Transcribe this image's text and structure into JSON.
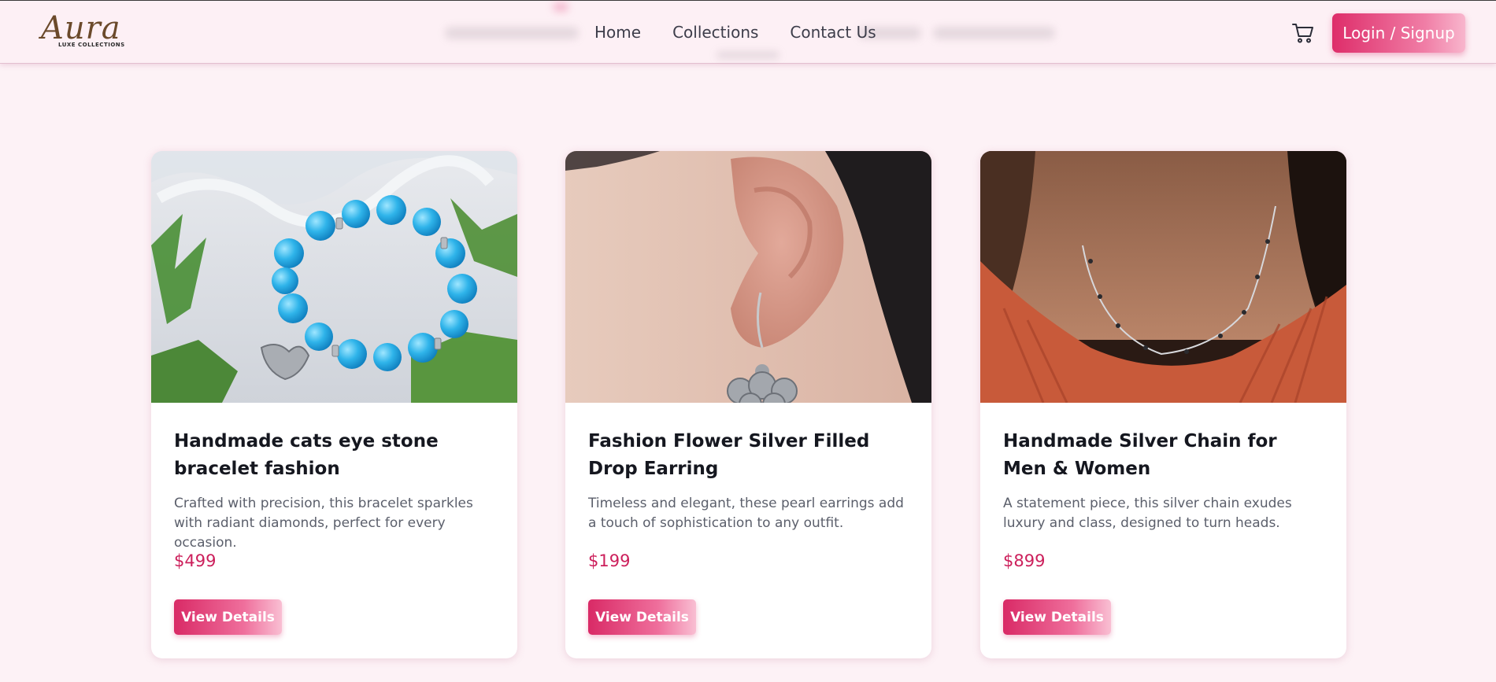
{
  "brand": {
    "logo_script": "Aura",
    "logo_sub": "LUXE COLLECTIONS"
  },
  "nav": {
    "items": [
      "Home",
      "Collections",
      "Contact Us"
    ]
  },
  "header": {
    "cart_icon": "cart-icon",
    "login_label": "Login / Signup"
  },
  "colors": {
    "accent": "#d92a66",
    "price": "#cc1f5b",
    "background": "#fdf2f6"
  },
  "products": [
    {
      "title": "Handmade cats eye stone bracelet fashion",
      "description": "Crafted with precision, this bracelet sparkles with radiant diamonds, perfect for every occasion.",
      "price": "$499",
      "button": "View Details"
    },
    {
      "title": "Fashion Flower Silver Filled Drop Earring",
      "description": "Timeless and elegant, these pearl earrings add a touch of sophistication to any outfit.",
      "price": "$199",
      "button": "View Details"
    },
    {
      "title": "Handmade Silver Chain for Men & Women",
      "description": "A statement piece, this silver chain exudes luxury and class, designed to turn heads.",
      "price": "$899",
      "button": "View Details"
    }
  ]
}
